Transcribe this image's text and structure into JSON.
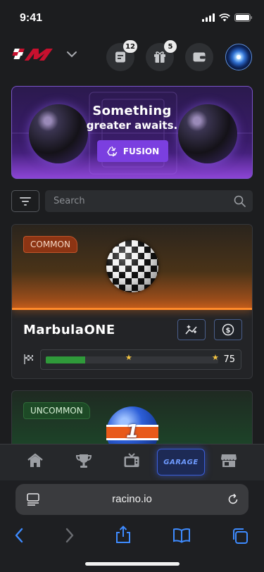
{
  "status_bar": {
    "time": "9:41"
  },
  "header": {
    "notes_badge": "12",
    "gifts_badge": "5"
  },
  "banner": {
    "title": "Something",
    "subtitle": "greater awaits.",
    "button_label": "FUSION"
  },
  "search": {
    "placeholder": "Search"
  },
  "cards": [
    {
      "rarity": "COMMON",
      "name": "MarbulaONE",
      "xp_value": "75",
      "xp_progress": 0.23
    },
    {
      "rarity": "UNCOMMON",
      "marble_number": "1"
    }
  ],
  "bottom_nav": {
    "garage_label": "GARAGE"
  },
  "browser": {
    "url": "racino.io"
  },
  "colors": {
    "accent_purple": "#7b3fe0",
    "garage_blue": "#3b5ed8",
    "progress_green": "#2f9a3a",
    "common_orange": "#8c3413",
    "uncommon_green": "#1d4a26"
  }
}
